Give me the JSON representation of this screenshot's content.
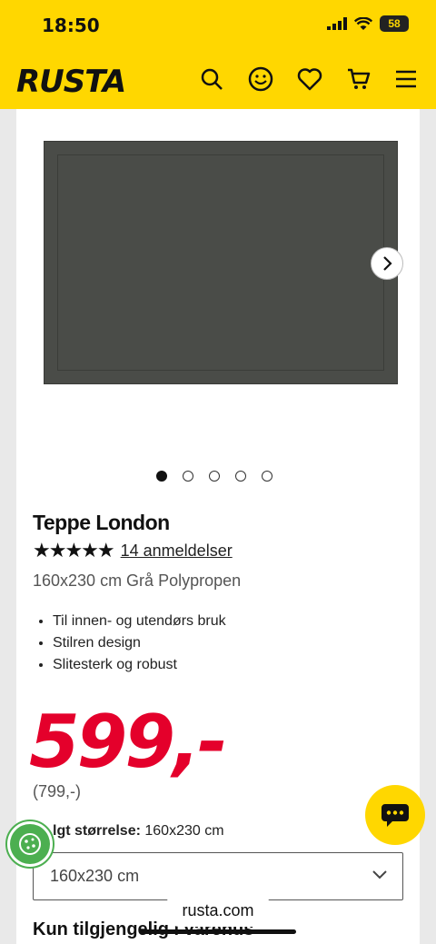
{
  "status": {
    "time": "18:50",
    "battery": "58"
  },
  "header": {
    "logo": "RUSTA",
    "icons": [
      "search-icon",
      "account-icon",
      "heart-icon",
      "cart-icon",
      "menu-icon"
    ]
  },
  "gallery": {
    "dots": 5,
    "active_index": 0
  },
  "product": {
    "title": "Teppe London",
    "rating_stars": "★★★★★",
    "rating_value": 4.5,
    "reviews_link": "14 anmeldelser",
    "subtitle": "160x230 cm Grå Polypropen",
    "features": [
      "Til innen- og utendørs bruk",
      "Stilren design",
      "Slitesterk og robust"
    ],
    "price": "599,-",
    "old_price": "(799,-)",
    "size_label_prefix": "lgt størrelse:",
    "size_label_value": "160x230 cm",
    "size_selected": "160x230 cm",
    "availability": "Kun tilgjengelig i varehus"
  },
  "browser": {
    "url": "rusta.com"
  },
  "colors": {
    "brand_yellow": "#ffd700",
    "price_red": "#e4002b",
    "cookie_green": "#4caf50"
  }
}
